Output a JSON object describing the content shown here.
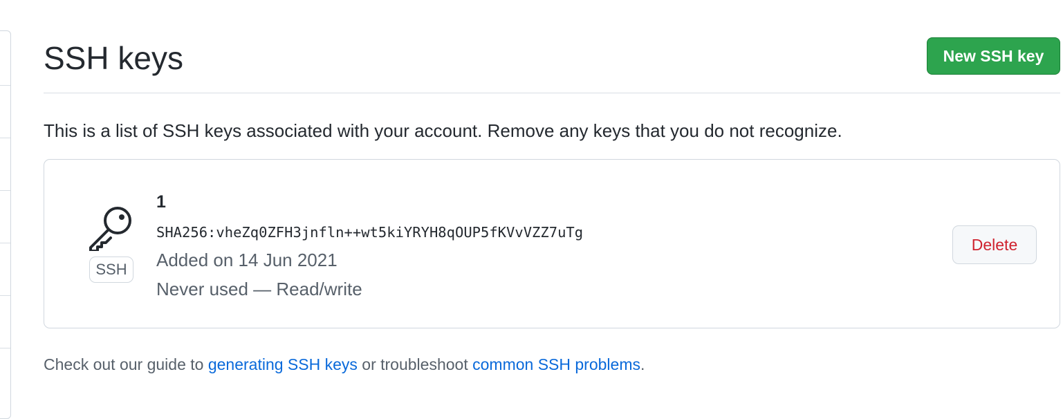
{
  "header": {
    "title": "SSH keys",
    "new_button_label": "New SSH key"
  },
  "intro": "This is a list of SSH keys associated with your account. Remove any keys that you do not recognize.",
  "keys": [
    {
      "title": "1",
      "type_label": "SSH",
      "fingerprint": "SHA256:vheZq0ZFH3jnfln++wt5kiYRYH8qOUP5fKVvVZZ7uTg",
      "added": "Added on 14 Jun 2021",
      "usage": "Never used — Read/write",
      "delete_label": "Delete",
      "icon": "key-icon"
    }
  ],
  "footer": {
    "prefix": "Check out our guide to ",
    "link1": "generating SSH keys",
    "middle": " or troubleshoot ",
    "link2": "common SSH problems",
    "suffix": "."
  },
  "colors": {
    "primary_button": "#2da44e",
    "danger_text": "#cf222e",
    "link": "#0969da",
    "muted_text": "#57606a",
    "border": "#d0d7de"
  }
}
